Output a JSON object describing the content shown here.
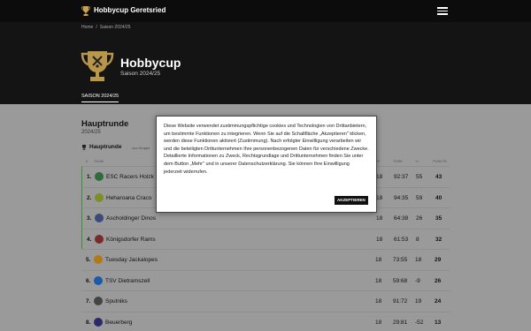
{
  "nav": {
    "brand": "Hobbycup Geretsried"
  },
  "breadcrumb": [
    "Home",
    "Saison 2024/25"
  ],
  "hero": {
    "title": "Hobbycup",
    "subtitle": "Saison 2024/25",
    "tab": "SAISON 2024/25"
  },
  "section": {
    "title": "Hauptrunde",
    "subtitle": "2024/25"
  },
  "group": {
    "name": "Hauptrunde",
    "note": "- zur Gruppe"
  },
  "table": {
    "headers": {
      "rank": "#",
      "team": "TEAM",
      "gp": "SP",
      "goals": "TORE",
      "diff": "+/-",
      "pts": "PUNKTE"
    },
    "rows": [
      {
        "rank": "1.",
        "team": "ESC Racers Holzk",
        "gp": "18",
        "goals": "92:37",
        "diff": "55",
        "pts": "43",
        "badge": "#2d6b3a"
      },
      {
        "rank": "2.",
        "team": "Heharoana Craco",
        "gp": "18",
        "goals": "94:35",
        "diff": "59",
        "pts": "40",
        "badge": "#7a8f2a"
      },
      {
        "rank": "3.",
        "team": "Ascholdinger Dinos",
        "gp": "18",
        "goals": "64:38",
        "diff": "26",
        "pts": "35",
        "badge": "#3a4a7a"
      },
      {
        "rank": "4.",
        "team": "Königsdorfer Rams",
        "gp": "18",
        "goals": "61:53",
        "diff": "8",
        "pts": "32",
        "badge": "#7a2a2a"
      },
      {
        "rank": "5.",
        "team": "Tuesday Jackalopes",
        "gp": "18",
        "goals": "73:55",
        "diff": "18",
        "pts": "29",
        "badge": "#b07a1a"
      },
      {
        "rank": "6.",
        "team": "TSV Dietramszell",
        "gp": "18",
        "goals": "59:68",
        "diff": "-9",
        "pts": "26",
        "badge": "#1a5aa8"
      },
      {
        "rank": "7.",
        "team": "Sputniks",
        "gp": "18",
        "goals": "91:72",
        "diff": "19",
        "pts": "24",
        "badge": "#444444"
      },
      {
        "rank": "8.",
        "team": "Beuerberg",
        "gp": "18",
        "goals": "29:81",
        "diff": "-52",
        "pts": "13",
        "badge": "#2a2a6a"
      }
    ]
  },
  "cookie": {
    "text": "Diese Website verwendet zustimmungspflichtige cookies und Technologien von Drittanbietern, um bestimmte Funktionen zu integrieren. Wenn Sie auf die Schaltfläche „Akzeptieren\" klicken, werden diese Funktionen aktiviert (Zustimmung). Nach erfolgter Einwilligung verarbeiten wir und die beteiligten Drittunternehmen Ihre personenbezogenen Daten für verschiedene Zwecke. Detaillierte Informationen zu Zweck, Rechtsgrundlage und Drittunternehmen finden Sie unter dem Button „Mehr\" und in unserer Datenschutzerklärung. Sie können Ihre Einwilligung jederzeit widerrufen.",
    "accept": "AKZEPTIEREN"
  },
  "colors": {
    "nav": "#0c0c0c",
    "hero": "#141414",
    "overlay_bg": "#9a9a9a",
    "qualify": "#3a8f3a"
  }
}
